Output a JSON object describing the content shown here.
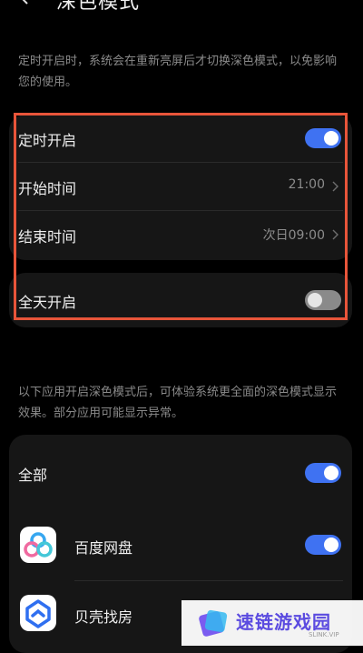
{
  "header": {
    "title": "深色模式"
  },
  "intro_text": "定时开启时，系统会在重新亮屏后才切换深色模式，以免影响您的使用。",
  "schedule": {
    "scheduled_on": {
      "label": "定时开启",
      "enabled": true
    },
    "start_time": {
      "label": "开始时间",
      "value": "21:00"
    },
    "end_time": {
      "label": "结束时间",
      "value": "次日09:00"
    }
  },
  "all_day": {
    "label": "全天开启",
    "enabled": false
  },
  "apps_note": "以下应用开启深色模式后，可体验系统更全面的深色模式显示效果。部分应用可能显示异常。",
  "apps": {
    "all": {
      "label": "全部",
      "enabled": true
    },
    "items": [
      {
        "label": "百度网盘",
        "enabled": true,
        "icon": "baidu-netdisk-icon"
      },
      {
        "label": "贝壳找房",
        "icon": "beike-icon"
      }
    ]
  },
  "watermark": {
    "text": "速链游戏园",
    "sub": "SLINK.VIP"
  },
  "colors": {
    "toggle_on": "#3f72f2",
    "highlight": "#e8553a",
    "background": "#000000"
  }
}
